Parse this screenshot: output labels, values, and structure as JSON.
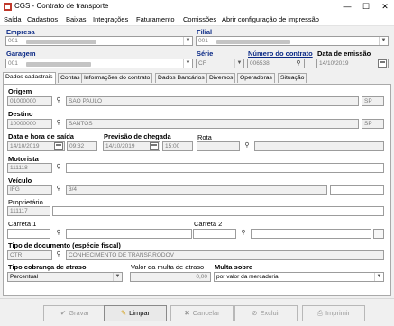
{
  "window": {
    "title": "CGS - Contrato de transporte",
    "minimize_glyph": "—",
    "maximize_glyph": "☐",
    "close_glyph": "✕"
  },
  "menu": [
    "Saída",
    "Cadastros",
    "Baixas",
    "Integrações",
    "Faturamento",
    "Comissões",
    "Abrir configuração de impressão"
  ],
  "header": {
    "empresa_label": "Empresa",
    "empresa_value": "001",
    "filial_label": "Filial",
    "filial_value": "001",
    "garagem_label": "Garagem",
    "garagem_value": "001",
    "serie_label": "Série",
    "serie_value": "CF",
    "numero_label": "Número do contrato",
    "numero_value": "006538",
    "data_emissao_label": "Data de emissão",
    "data_emissao_value": "14/10/2019"
  },
  "tabs": [
    "Dados cadastrais",
    "Contas",
    "Informações do contrato",
    "Dados Bancários",
    "Diversos",
    "Operadoras",
    "Situação"
  ],
  "form": {
    "origem_label": "Origem",
    "origem_code": "01000000",
    "origem_city": "SAO PAULO",
    "origem_uf": "SP",
    "destino_label": "Destino",
    "destino_code": "10000000",
    "destino_city": "SANTOS",
    "destino_uf": "SP",
    "saida_label": "Data e hora de saída",
    "saida_date": "14/10/2019",
    "saida_time": "09:32",
    "chegada_label": "Previsão de chegada",
    "chegada_date": "14/10/2019",
    "chegada_time": "15:00",
    "rota_label": "Rota",
    "motorista_label": "Motorista",
    "motorista_code": "111118",
    "veiculo_label": "Veículo",
    "veiculo_code": "IFG",
    "veiculo_desc": "3/4",
    "proprietario_label": "Proprietário",
    "proprietario_code": "111117",
    "carreta1_label": "Carreta 1",
    "carreta2_label": "Carreta 2",
    "tipo_doc_label": "Tipo de documento (espécie fiscal)",
    "tipo_doc_code": "CTR",
    "tipo_doc_desc": "CONHECIMENTO DE TRANSP.RODOV",
    "cobranca_label": "Tipo cobrança de atraso",
    "cobranca_value": "Percentual",
    "multa_valor_label": "Valor da multa de atraso",
    "multa_valor_value": "0,00",
    "multa_sobre_label": "Multa sobre",
    "multa_sobre_value": "por valor da mercadoria"
  },
  "buttons": {
    "gravar": "Gravar",
    "limpar": "Limpar",
    "cancelar": "Cancelar",
    "excluir": "Excluir",
    "imprimir": "Imprimir"
  },
  "icons": {
    "lookup": "magnifier-icon",
    "calendar": "calendar-icon",
    "dropdown": "chevron-down-icon"
  }
}
